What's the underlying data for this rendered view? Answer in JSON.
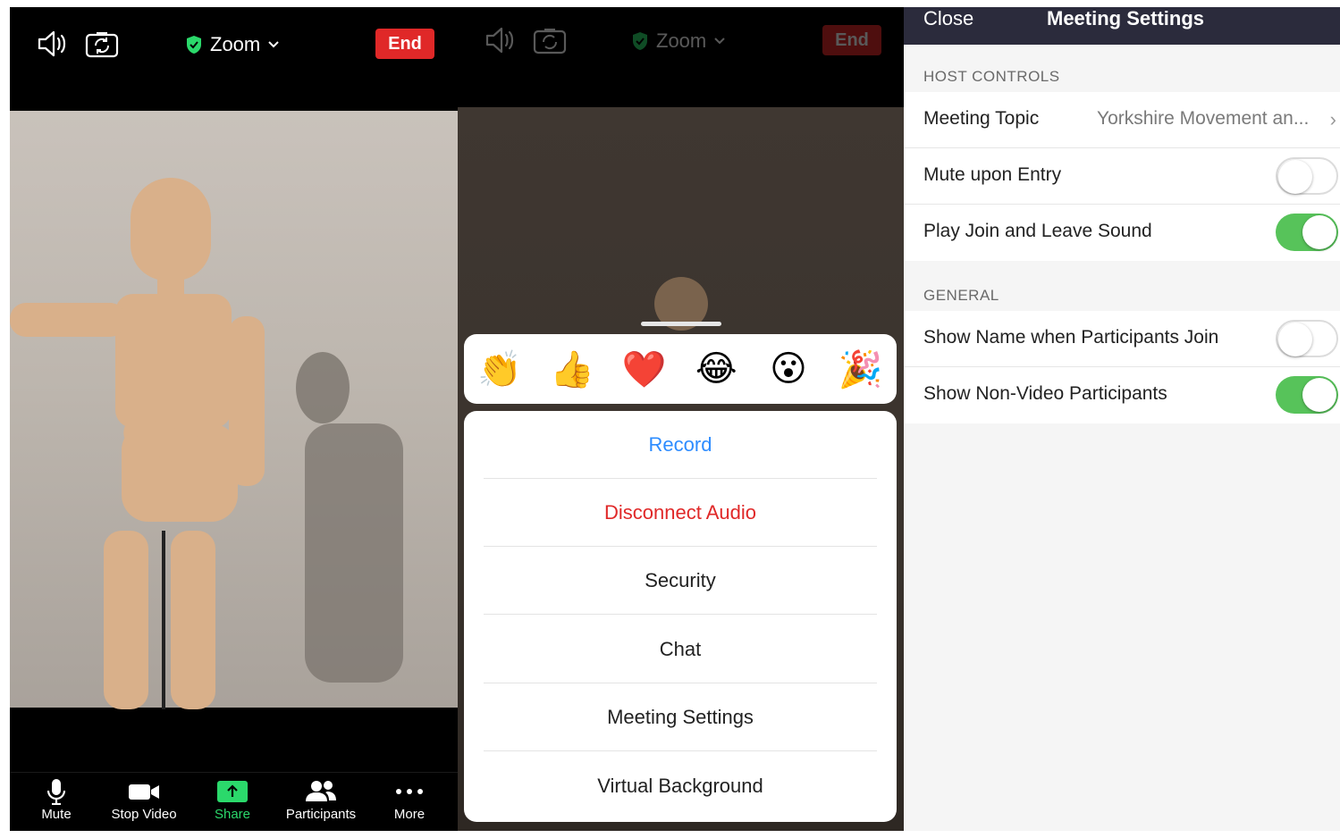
{
  "meeting": {
    "title": "Zoom",
    "end_label": "End"
  },
  "toolbar": {
    "items": [
      {
        "label": "Mute",
        "icon": "microphone-icon"
      },
      {
        "label": "Stop Video",
        "icon": "video-camera-icon"
      },
      {
        "label": "Share",
        "icon": "share-arrow-icon"
      },
      {
        "label": "Participants",
        "icon": "participants-icon"
      },
      {
        "label": "More",
        "icon": "more-dots-icon"
      }
    ],
    "share_color": "#2bd96b"
  },
  "reactions": [
    "👏",
    "👍",
    "❤️",
    "😂",
    "😮",
    "🎉"
  ],
  "more_menu": {
    "items": [
      {
        "label": "Record",
        "color": "#2d8cff"
      },
      {
        "label": "Disconnect Audio",
        "color": "#e02828"
      },
      {
        "label": "Security",
        "color": "#222222"
      },
      {
        "label": "Chat",
        "color": "#222222"
      },
      {
        "label": "Meeting Settings",
        "color": "#222222"
      },
      {
        "label": "Virtual Background",
        "color": "#222222"
      }
    ]
  },
  "settings": {
    "close_label": "Close",
    "title": "Meeting Settings",
    "host_controls_header": "HOST CONTROLS",
    "meeting_topic_label": "Meeting Topic",
    "meeting_topic_value": "Yorkshire Movement an...",
    "mute_upon_entry_label": "Mute upon Entry",
    "mute_upon_entry_on": false,
    "join_leave_sound_label": "Play Join and Leave Sound",
    "join_leave_sound_on": true,
    "general_header": "GENERAL",
    "show_name_label": "Show Name when Participants Join",
    "show_name_on": false,
    "show_non_video_label": "Show Non-Video Participants",
    "show_non_video_on": true
  },
  "colors": {
    "end_red": "#e02828",
    "toggle_green": "#57c35a",
    "secure_green": "#2bd96b",
    "navbar": "#2b2b3c"
  }
}
